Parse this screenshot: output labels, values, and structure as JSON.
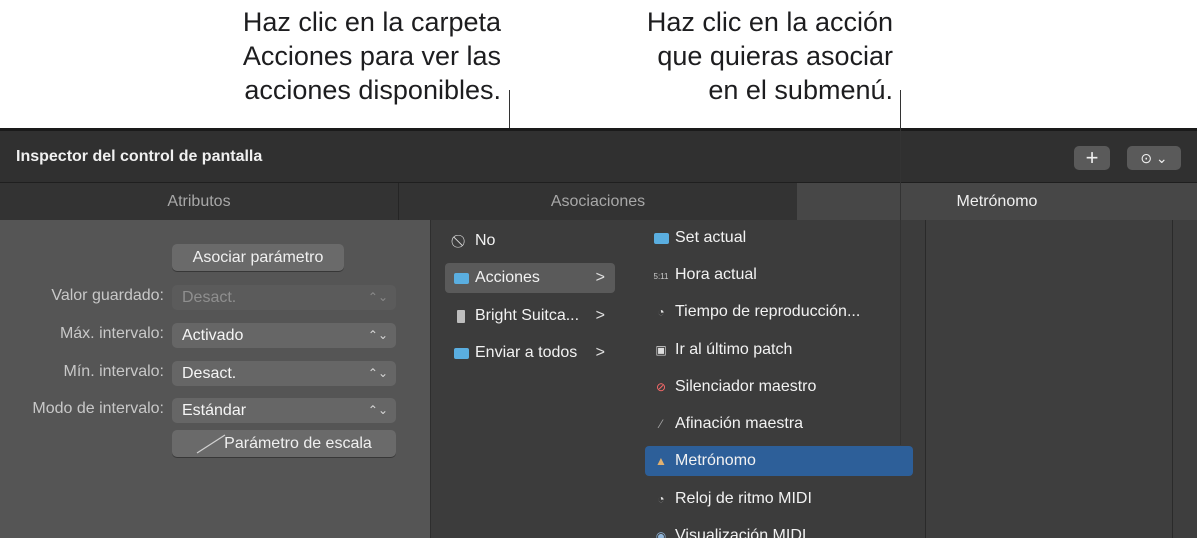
{
  "callouts": {
    "left": [
      "Haz clic en la carpeta",
      "Acciones para ver las",
      "acciones disponibles."
    ],
    "right": [
      "Haz clic en la acción",
      "que quieras asociar",
      "en el submenú."
    ]
  },
  "window": {
    "title": "Inspector del control de pantalla",
    "plus_label": "+",
    "more_label": "⊙ ⌄"
  },
  "tabs": [
    "Atributos",
    "Asociaciones",
    "Metrónomo"
  ],
  "attributes": {
    "assign_button": "Asociar parámetro",
    "fields": [
      {
        "label": "Valor guardado:",
        "value": "Desact.",
        "enabled": false
      },
      {
        "label": "Máx. intervalo:",
        "value": "Activado",
        "enabled": true
      },
      {
        "label": "Mín. intervalo:",
        "value": "Desact.",
        "enabled": true
      },
      {
        "label": "Modo de intervalo:",
        "value": "Estándar",
        "enabled": true
      }
    ],
    "scale_button": "Parámetro de escala"
  },
  "browser": {
    "column1": [
      {
        "label": "No",
        "icon": "no-icon",
        "chevron": ""
      },
      {
        "label": "Acciones",
        "icon": "folder-icon",
        "chevron": ">"
      },
      {
        "label": "Bright Suitca...",
        "icon": "device-icon",
        "chevron": ">"
      },
      {
        "label": "Enviar a todos",
        "icon": "folder-icon",
        "chevron": ">"
      }
    ],
    "column2": [
      {
        "label": "Set actual",
        "icon": "folder-icon"
      },
      {
        "label": "Hora actual",
        "icon": "clock-icon"
      },
      {
        "label": "Tiempo de reproducción...",
        "icon": "timer-icon"
      },
      {
        "label": "Ir al último patch",
        "icon": "patch-icon"
      },
      {
        "label": "Silenciador maestro",
        "icon": "mute-icon"
      },
      {
        "label": "Afinación maestra",
        "icon": "tuning-icon"
      },
      {
        "label": "Metrónomo",
        "icon": "metronome-icon"
      },
      {
        "label": "Reloj de ritmo MIDI",
        "icon": "midi-clock-icon"
      },
      {
        "label": "Visualización MIDI",
        "icon": "midi-display-icon"
      }
    ],
    "selected_action": "Metrónomo"
  },
  "colors": {
    "highlight": "#2d5f99",
    "panel_bg": "#3a3a3a",
    "folder": "#5aaee0"
  }
}
